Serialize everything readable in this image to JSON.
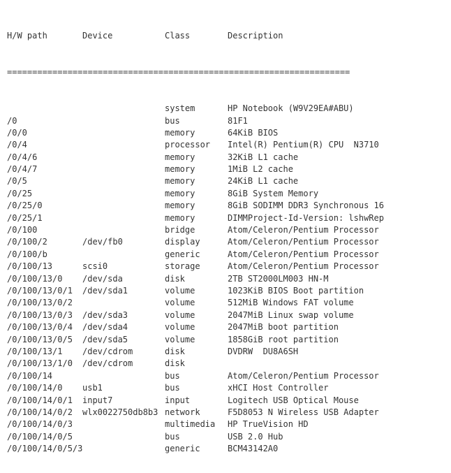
{
  "header": {
    "hw_path": "H/W path",
    "device": "Device",
    "class": "Class",
    "description": "Description"
  },
  "separator": "====================================================================",
  "rows": [
    {
      "hw": "",
      "dev": "",
      "cls": "system",
      "desc": "HP Notebook (W9V29EA#ABU)"
    },
    {
      "hw": "/0",
      "dev": "",
      "cls": "bus",
      "desc": "81F1"
    },
    {
      "hw": "/0/0",
      "dev": "",
      "cls": "memory",
      "desc": "64KiB BIOS"
    },
    {
      "hw": "/0/4",
      "dev": "",
      "cls": "processor",
      "desc": "Intel(R) Pentium(R) CPU  N3710"
    },
    {
      "hw": "/0/4/6",
      "dev": "",
      "cls": "memory",
      "desc": "32KiB L1 cache"
    },
    {
      "hw": "/0/4/7",
      "dev": "",
      "cls": "memory",
      "desc": "1MiB L2 cache"
    },
    {
      "hw": "/0/5",
      "dev": "",
      "cls": "memory",
      "desc": "24KiB L1 cache"
    },
    {
      "hw": "/0/25",
      "dev": "",
      "cls": "memory",
      "desc": "8GiB System Memory"
    },
    {
      "hw": "/0/25/0",
      "dev": "",
      "cls": "memory",
      "desc": "8GiB SODIMM DDR3 Synchronous 16"
    },
    {
      "hw": "/0/25/1",
      "dev": "",
      "cls": "memory",
      "desc": "DIMMProject-Id-Version: lshwRep"
    },
    {
      "hw": "/0/100",
      "dev": "",
      "cls": "bridge",
      "desc": "Atom/Celeron/Pentium Processor"
    },
    {
      "hw": "/0/100/2",
      "dev": "/dev/fb0",
      "cls": "display",
      "desc": "Atom/Celeron/Pentium Processor"
    },
    {
      "hw": "/0/100/b",
      "dev": "",
      "cls": "generic",
      "desc": "Atom/Celeron/Pentium Processor"
    },
    {
      "hw": "/0/100/13",
      "dev": "scsi0",
      "cls": "storage",
      "desc": "Atom/Celeron/Pentium Processor"
    },
    {
      "hw": "/0/100/13/0",
      "dev": "/dev/sda",
      "cls": "disk",
      "desc": "2TB ST2000LM003 HN-M"
    },
    {
      "hw": "/0/100/13/0/1",
      "dev": "/dev/sda1",
      "cls": "volume",
      "desc": "1023KiB BIOS Boot partition"
    },
    {
      "hw": "/0/100/13/0/2",
      "dev": "",
      "cls": "volume",
      "desc": "512MiB Windows FAT volume"
    },
    {
      "hw": "/0/100/13/0/3",
      "dev": "/dev/sda3",
      "cls": "volume",
      "desc": "2047MiB Linux swap volume"
    },
    {
      "hw": "/0/100/13/0/4",
      "dev": "/dev/sda4",
      "cls": "volume",
      "desc": "2047MiB boot partition"
    },
    {
      "hw": "/0/100/13/0/5",
      "dev": "/dev/sda5",
      "cls": "volume",
      "desc": "1858GiB root partition"
    },
    {
      "hw": "/0/100/13/1",
      "dev": "/dev/cdrom",
      "cls": "disk",
      "desc": "DVDRW  DU8A6SH"
    },
    {
      "hw": "/0/100/13/1/0",
      "dev": "/dev/cdrom",
      "cls": "disk",
      "desc": ""
    },
    {
      "hw": "/0/100/14",
      "dev": "",
      "cls": "bus",
      "desc": "Atom/Celeron/Pentium Processor"
    },
    {
      "hw": "/0/100/14/0",
      "dev": "usb1",
      "cls": "bus",
      "desc": "xHCI Host Controller"
    },
    {
      "hw": "/0/100/14/0/1",
      "dev": "input7",
      "cls": "input",
      "desc": "Logitech USB Optical Mouse"
    },
    {
      "hw": "/0/100/14/0/2",
      "dev": "wlx0022750db8b3",
      "cls": "network",
      "desc": "F5D8053 N Wireless USB Adapter"
    },
    {
      "hw": "/0/100/14/0/3",
      "dev": "",
      "cls": "multimedia",
      "desc": "HP TrueVision HD"
    },
    {
      "hw": "/0/100/14/0/5",
      "dev": "",
      "cls": "bus",
      "desc": "USB 2.0 Hub"
    },
    {
      "hw": "/0/100/14/0/5/3",
      "dev": "",
      "cls": "generic",
      "desc": "BCM43142A0"
    }
  ]
}
